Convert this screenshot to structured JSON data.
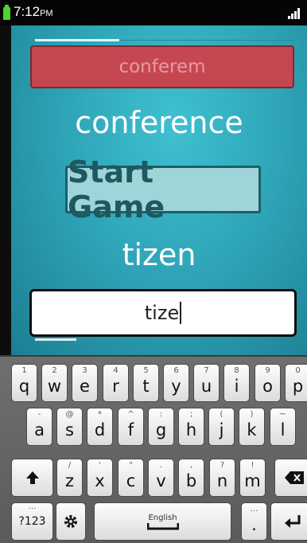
{
  "status": {
    "time": "7:12",
    "ampm": "PM"
  },
  "game": {
    "guess": "conferem",
    "target_word": "conference",
    "start_button": "Start Game",
    "current_word": "tizen",
    "input_value": "tize"
  },
  "keyboard": {
    "row1": [
      {
        "k": "q",
        "h": "1"
      },
      {
        "k": "w",
        "h": "2"
      },
      {
        "k": "e",
        "h": "3"
      },
      {
        "k": "r",
        "h": "4"
      },
      {
        "k": "t",
        "h": "5"
      },
      {
        "k": "y",
        "h": "6"
      },
      {
        "k": "u",
        "h": "7"
      },
      {
        "k": "i",
        "h": "8"
      },
      {
        "k": "o",
        "h": "9"
      },
      {
        "k": "p",
        "h": "0"
      }
    ],
    "row2": [
      {
        "k": "a",
        "h": "-"
      },
      {
        "k": "s",
        "h": "@"
      },
      {
        "k": "d",
        "h": "*"
      },
      {
        "k": "f",
        "h": "^"
      },
      {
        "k": "g",
        "h": ":"
      },
      {
        "k": "h",
        "h": ";"
      },
      {
        "k": "j",
        "h": "("
      },
      {
        "k": "k",
        "h": ")"
      },
      {
        "k": "l",
        "h": "~"
      }
    ],
    "row3": [
      {
        "k": "z",
        "h": "/"
      },
      {
        "k": "x",
        "h": "'"
      },
      {
        "k": "c",
        "h": "\""
      },
      {
        "k": "v",
        "h": "."
      },
      {
        "k": "b",
        "h": ","
      },
      {
        "k": "n",
        "h": "?"
      },
      {
        "k": "m",
        "h": "!"
      }
    ],
    "symbols_label": "?123",
    "space_label": "English",
    "period_key": ".",
    "period_hint": "..."
  }
}
